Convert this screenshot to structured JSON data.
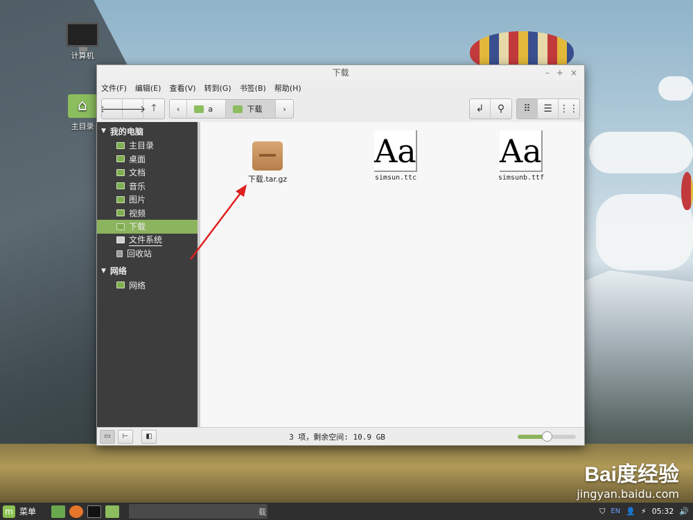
{
  "desktop": {
    "icons": [
      {
        "label": "计算机"
      },
      {
        "label": "主目录"
      }
    ]
  },
  "window": {
    "title": "下载",
    "controls": [
      "–",
      "+",
      "×"
    ]
  },
  "menubar": [
    "文件(F)",
    "编辑(E)",
    "查看(V)",
    "转到(G)",
    "书签(B)",
    "帮助(H)"
  ],
  "toolbar": {
    "path": [
      "a",
      "下载"
    ]
  },
  "sidebar": {
    "sections": [
      {
        "title": "我的电脑",
        "items": [
          "主目录",
          "桌面",
          "文档",
          "音乐",
          "图片",
          "视频",
          "下载",
          "文件系统",
          "回收站"
        ]
      },
      {
        "title": "网络",
        "items": [
          "网络"
        ]
      }
    ],
    "selected": "下载"
  },
  "files": [
    {
      "name": "下载.tar.gz",
      "type": "archive"
    },
    {
      "name": "simsun.ttc",
      "type": "font",
      "glyph": "Aa"
    },
    {
      "name": "simsunb.ttf",
      "type": "font",
      "glyph": "Aa"
    }
  ],
  "statusbar": {
    "text": "3 项，剩余空间: 10.9 GB",
    "zoom_level": 0.5
  },
  "taskbar": {
    "menu_label": "菜单",
    "task_title": "载",
    "tray_lang": "EN",
    "clock": "05:32"
  },
  "watermark": {
    "logo": "Bai度经验",
    "url": "jingyan.baidu.com"
  },
  "colors": {
    "accent": "#8cb35d",
    "sidebar_bg": "#3d3d3d",
    "arrow": "#e02020"
  }
}
